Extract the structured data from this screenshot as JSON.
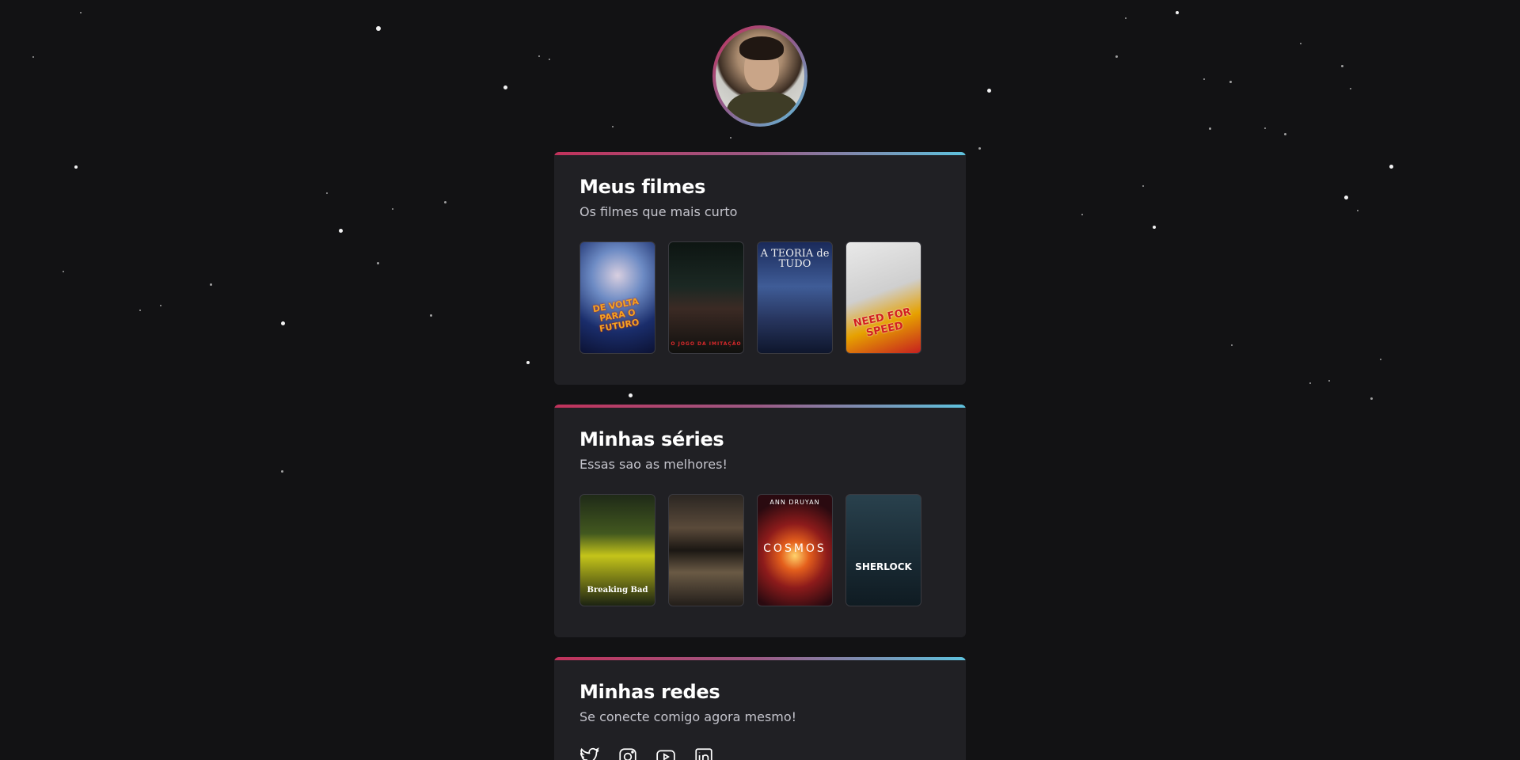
{
  "profile": {
    "avatar_icon": "profile-photo"
  },
  "sections": {
    "movies": {
      "title": "Meus filmes",
      "subtitle": "Os filmes que mais curto",
      "posters": [
        {
          "text": "DE VOLTA PARA O FUTURO"
        },
        {
          "text": "O JOGO DA IMITAÇÃO"
        },
        {
          "text": "A TEORIA de TUDO"
        },
        {
          "text": "NEED FOR SPEED"
        }
      ]
    },
    "series": {
      "title": "Minhas séries",
      "subtitle": "Essas sao as melhores!",
      "posters": [
        {
          "text": "Breaking Bad"
        },
        {
          "text": ""
        },
        {
          "text_top": "ANN DRUYAN",
          "text": "COSMOS"
        },
        {
          "text": "SHERLOCK"
        }
      ]
    },
    "social": {
      "title": "Minhas redes",
      "subtitle": "Se conecte comigo agora mesmo!",
      "icons": [
        "twitter-icon",
        "instagram-icon",
        "youtube-icon",
        "linkedin-icon"
      ]
    }
  },
  "colors": {
    "background": "#121214",
    "card": "#202024",
    "gradient_start": "#c1325b",
    "gradient_end": "#5ec2de"
  }
}
